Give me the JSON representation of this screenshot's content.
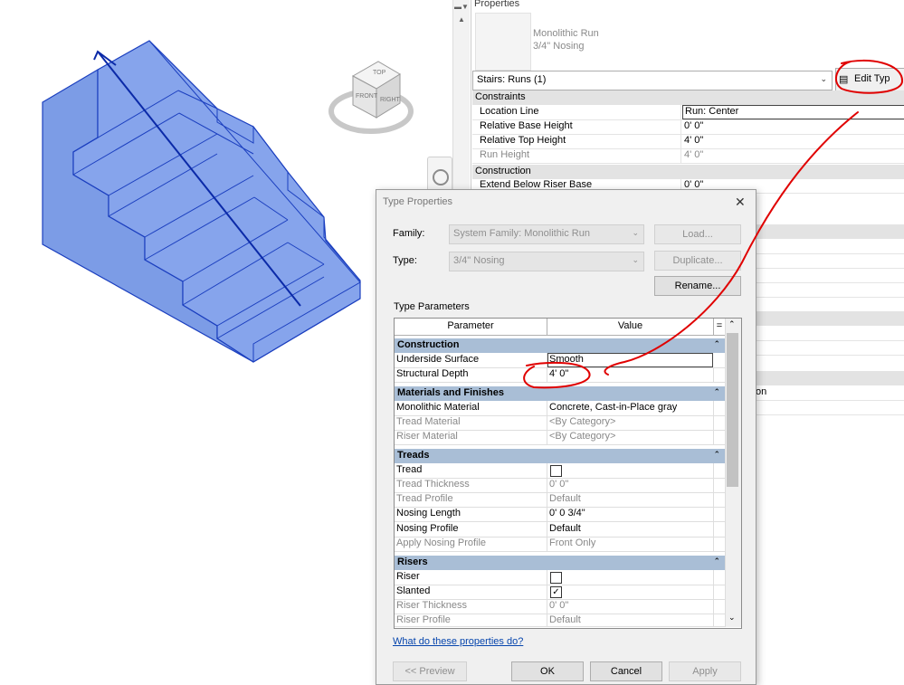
{
  "properties": {
    "title": "Properties",
    "family_name": "Monolithic Run",
    "family_type": "3/4\" Nosing",
    "type_selector": "Stairs: Runs (1)",
    "edit_type_label": "Edit Typ",
    "groups": [
      {
        "label": "Constraints",
        "rows": [
          {
            "key": "Location Line",
            "value": "Run: Center"
          },
          {
            "key": "Relative Base Height",
            "value": "0'  0\""
          },
          {
            "key": "Relative Top Height",
            "value": "4'  0\""
          },
          {
            "key": "Run Height",
            "value": "4'  0\""
          }
        ]
      },
      {
        "label": "Construction",
        "rows": [
          {
            "key": "Extend Below Riser Base",
            "value": "0'  0\""
          }
        ]
      }
    ],
    "partial_text": "on"
  },
  "viewcube": {
    "top": "TOP",
    "front": "FRONT",
    "right": "RIGHT"
  },
  "dialog": {
    "title": "Type Properties",
    "family_label": "Family:",
    "family_value": "System Family: Monolithic Run",
    "type_label": "Type:",
    "type_value": "3/4\" Nosing",
    "load_label": "Load...",
    "duplicate_label": "Duplicate...",
    "rename_label": "Rename...",
    "type_params_label": "Type Parameters",
    "col_parameter": "Parameter",
    "col_value": "Value",
    "col_eq": "=",
    "sections": {
      "construction": "Construction",
      "materials": "Materials and Finishes",
      "treads": "Treads",
      "risers": "Risers"
    },
    "rows": {
      "underside_surface": {
        "key": "Underside Surface",
        "value": "Smooth"
      },
      "structural_depth": {
        "key": "Structural Depth",
        "value": "4'  0\""
      },
      "monolithic_material": {
        "key": "Monolithic Material",
        "value": "Concrete, Cast-in-Place gray"
      },
      "tread_material": {
        "key": "Tread Material",
        "value": "<By Category>"
      },
      "riser_material": {
        "key": "Riser Material",
        "value": "<By Category>"
      },
      "tread": {
        "key": "Tread"
      },
      "tread_thickness": {
        "key": "Tread Thickness",
        "value": "0'  0\""
      },
      "tread_profile": {
        "key": "Tread Profile",
        "value": "Default"
      },
      "nosing_length": {
        "key": "Nosing Length",
        "value": "0'  0 3/4\""
      },
      "nosing_profile": {
        "key": "Nosing Profile",
        "value": "Default"
      },
      "apply_nosing_profile": {
        "key": "Apply Nosing Profile",
        "value": "Front Only"
      },
      "riser": {
        "key": "Riser"
      },
      "slanted": {
        "key": "Slanted"
      },
      "riser_thickness": {
        "key": "Riser Thickness",
        "value": "0'  0\""
      },
      "riser_profile": {
        "key": "Riser Profile",
        "value": "Default"
      }
    },
    "help_link": "What do these properties do?",
    "preview_label": "<< Preview",
    "ok_label": "OK",
    "cancel_label": "Cancel",
    "apply_label": "Apply"
  },
  "colors": {
    "section_header": "#a9bed6",
    "stair_fill": "#7a9ae6",
    "stair_edge": "#1b3fbf",
    "annotation": "#e00000"
  }
}
